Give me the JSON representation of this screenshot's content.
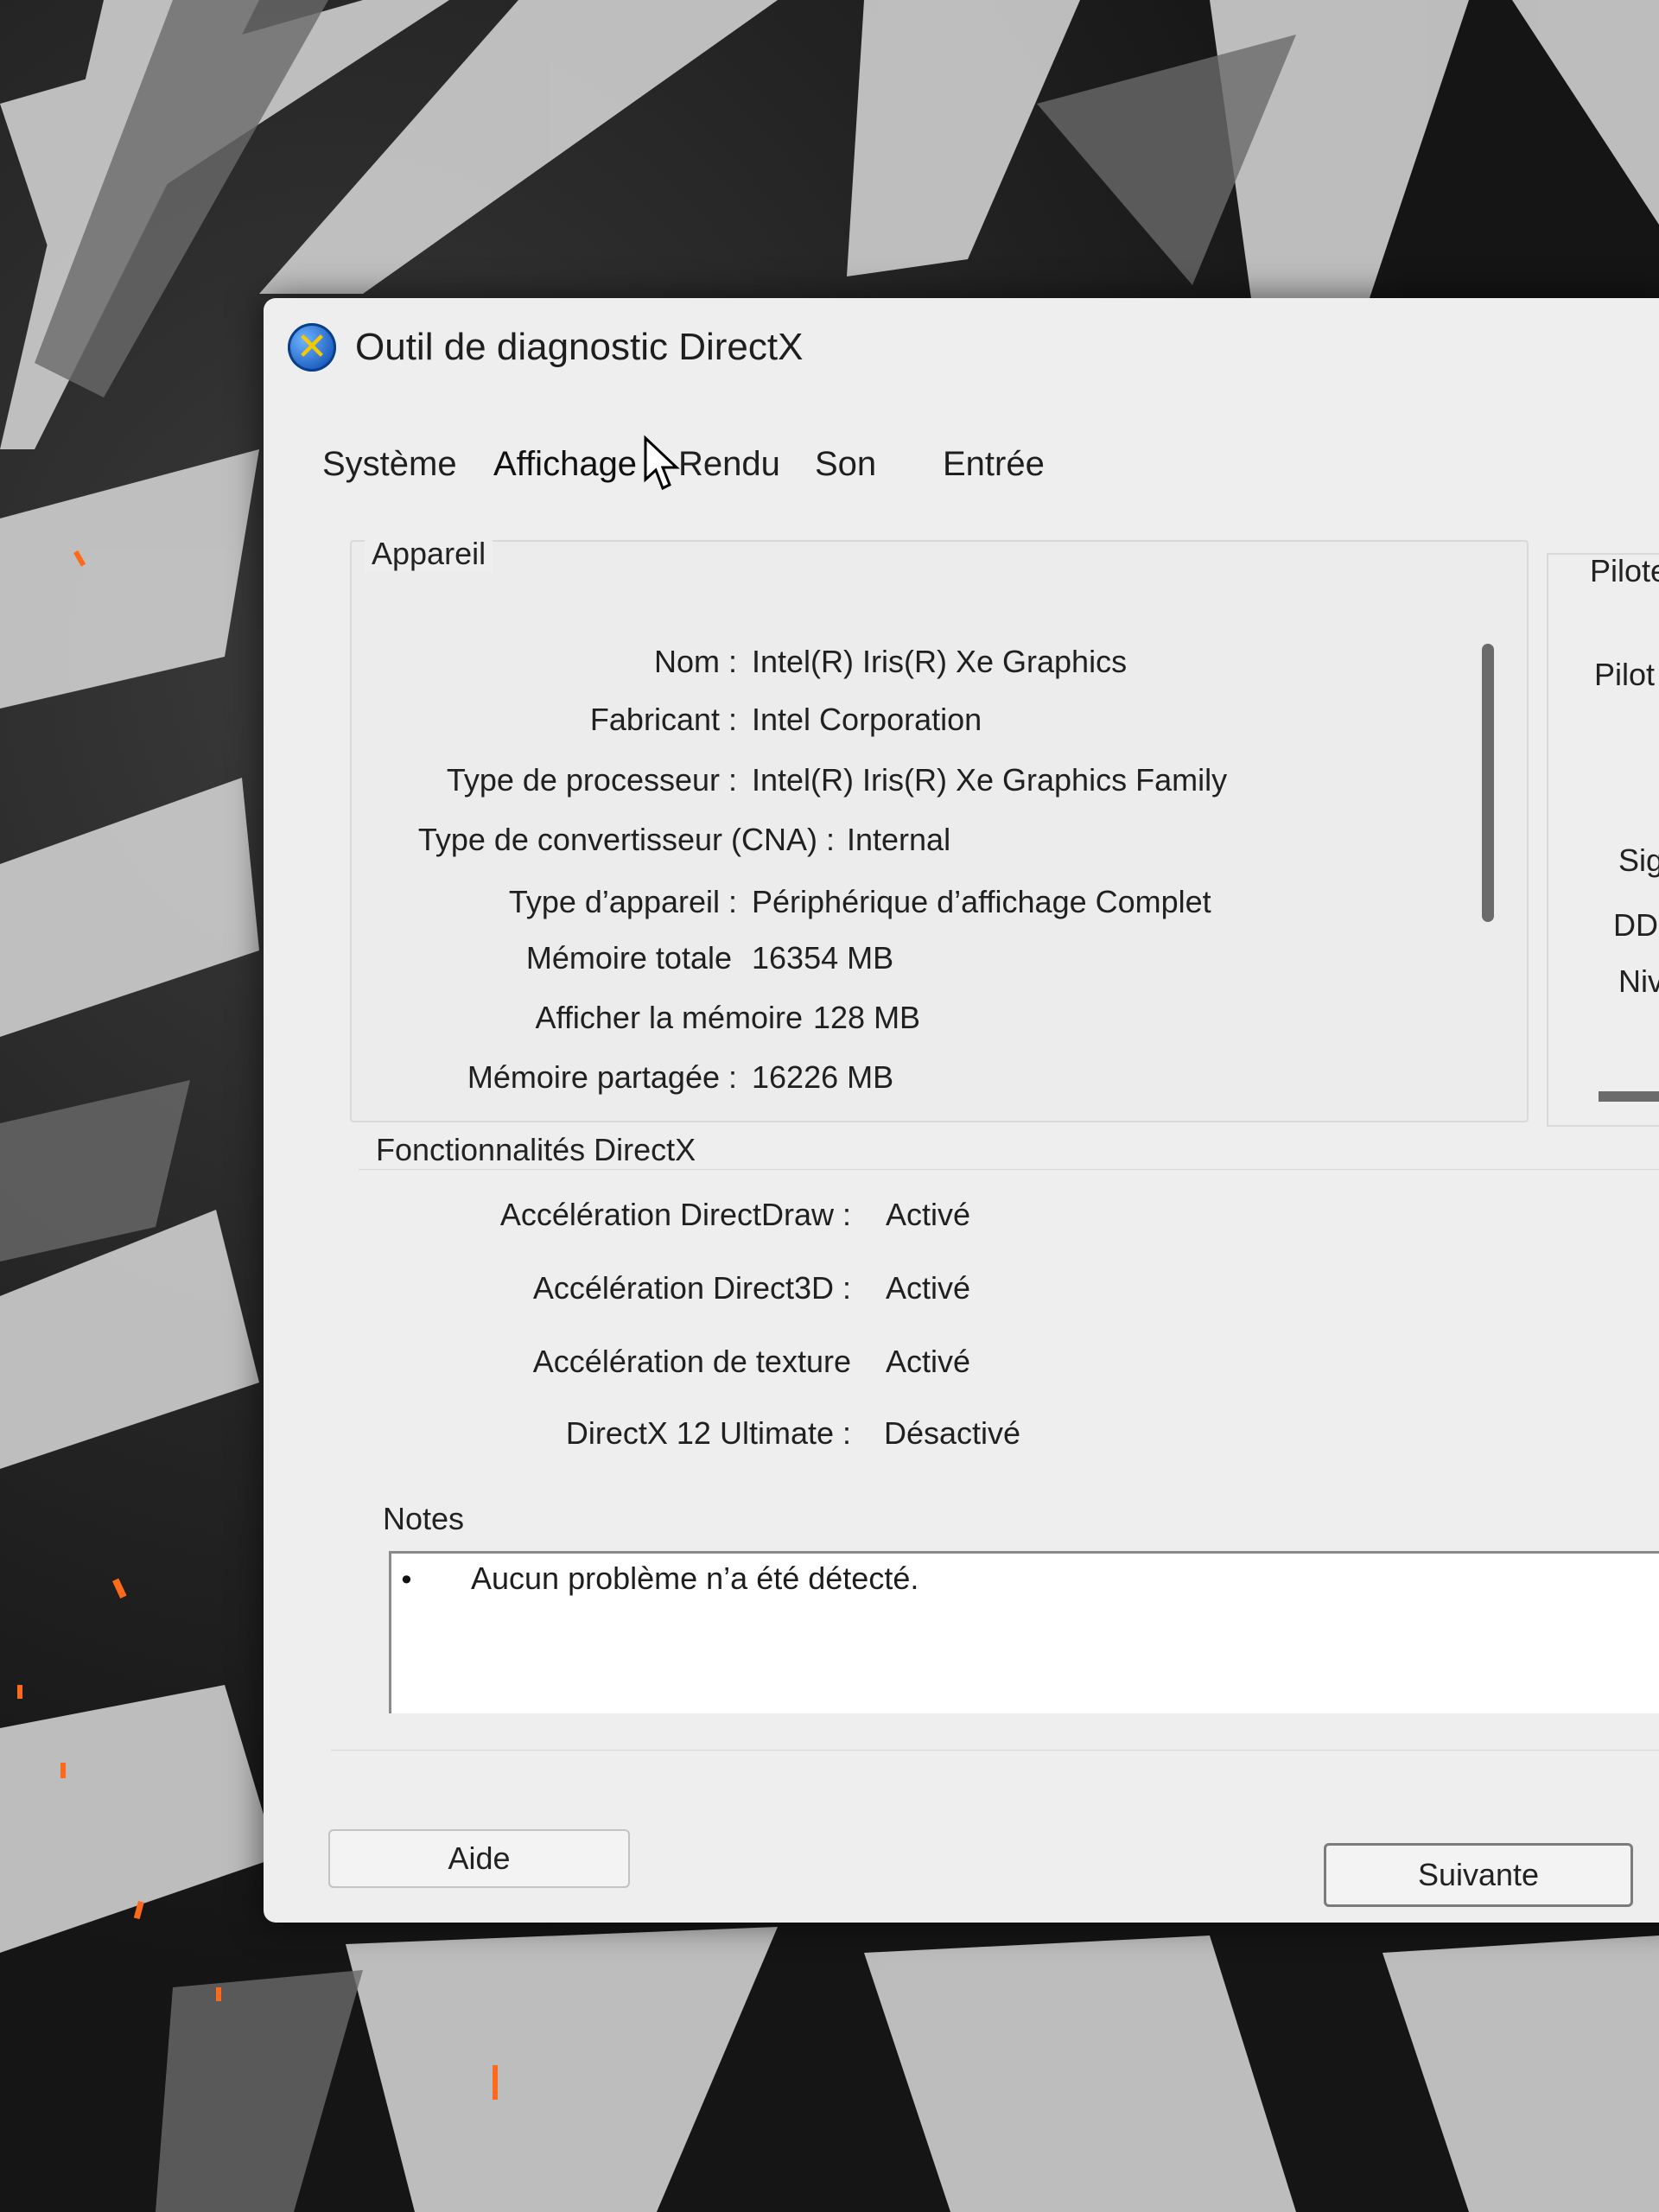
{
  "window": {
    "title": "Outil de diagnostic DirectX",
    "icon": "directx-icon"
  },
  "tabs": [
    {
      "label": "Système"
    },
    {
      "label": "Affichage",
      "active": true
    },
    {
      "label": "Rendu"
    },
    {
      "label": "Son"
    },
    {
      "label": "Entrée"
    }
  ],
  "device": {
    "group_label": "Appareil",
    "rows": [
      {
        "label": "Nom :",
        "value": "Intel(R) Iris(R) Xe Graphics"
      },
      {
        "label": "Fabricant :",
        "value": "Intel Corporation"
      },
      {
        "label": "Type de processeur :",
        "value": "Intel(R) Iris(R) Xe Graphics Family"
      },
      {
        "label": "Type de convertisseur (CNA) :",
        "value": "Internal"
      },
      {
        "label": "Type d’appareil :",
        "value": "Périphérique d’affichage Complet"
      },
      {
        "label": "Mémoire totale",
        "value": "16354 MB"
      },
      {
        "label": "Afficher la mémoire",
        "value": "128 MB"
      },
      {
        "label": "Mémoire partagée :",
        "value": "16226 MB"
      }
    ]
  },
  "right_panel": {
    "labels": [
      "Pilote",
      "Pilot",
      "Sig",
      "DD",
      "Niv"
    ]
  },
  "features": {
    "group_label": "Fonctionnalités DirectX",
    "rows": [
      {
        "label": "Accélération DirectDraw :",
        "value": "Activé"
      },
      {
        "label": "Accélération Direct3D :",
        "value": "Activé"
      },
      {
        "label": "Accélération de texture",
        "value": "Activé"
      },
      {
        "label": "DirectX 12 Ultimate :",
        "value": "Désactivé"
      }
    ]
  },
  "notes": {
    "label": "Notes",
    "bullet": "•",
    "text": "Aucun problème n’a été détecté."
  },
  "buttons": {
    "help": "Aide",
    "next": "Suivante"
  }
}
